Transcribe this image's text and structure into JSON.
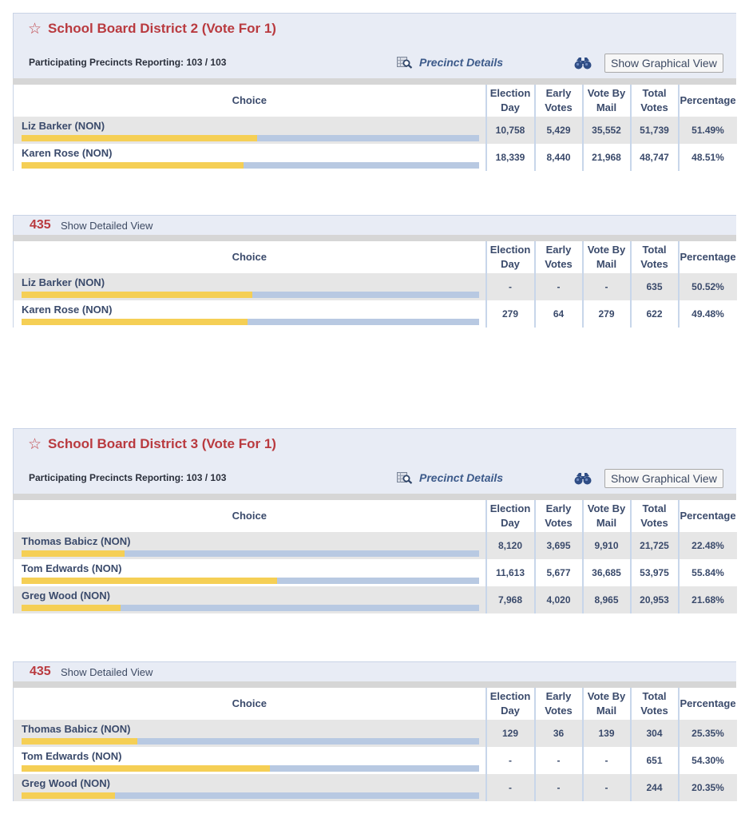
{
  "common": {
    "choice_header": "Choice",
    "columns": [
      {
        "line1": "Election",
        "line2": "Day"
      },
      {
        "line1": "Early",
        "line2": "Votes"
      },
      {
        "line1": "Vote By",
        "line2": "Mail"
      },
      {
        "line1": "Total",
        "line2": "Votes"
      },
      {
        "line1": "Percentage",
        "line2": ""
      }
    ],
    "precinct_details_label": "Precinct Details",
    "show_graphical_view_label": "Show Graphical View",
    "show_detailed_view_label": "Show Detailed View",
    "star_glyph": "☆",
    "colors": {
      "title": "#b93a3f",
      "bar_fill": "#f5cf55",
      "bar_track": "#b8c9e2",
      "header_bg": "#e8ecf5",
      "row_alt_bg": "#e6e6e6"
    }
  },
  "contests": [
    {
      "title": "School Board District 2 (Vote For 1)",
      "reporting": "Participating Precincts Reporting: 103 / 103",
      "rows": [
        {
          "name": "Liz Barker (NON)",
          "election_day": "10,758",
          "early": "5,429",
          "mail": "35,552",
          "total": "51,739",
          "pct": "51.49%",
          "share": 51.49
        },
        {
          "name": "Karen Rose (NON)",
          "election_day": "18,339",
          "early": "8,440",
          "mail": "21,968",
          "total": "48,747",
          "pct": "48.51%",
          "share": 48.51
        }
      ],
      "precinct": {
        "number": "435",
        "rows": [
          {
            "name": "Liz Barker (NON)",
            "election_day": "-",
            "early": "-",
            "mail": "-",
            "total": "635",
            "pct": "50.52%",
            "share": 50.52
          },
          {
            "name": "Karen Rose (NON)",
            "election_day": "279",
            "early": "64",
            "mail": "279",
            "total": "622",
            "pct": "49.48%",
            "share": 49.48
          }
        ]
      }
    },
    {
      "title": "School Board District 3 (Vote For 1)",
      "reporting": "Participating Precincts Reporting: 103 / 103",
      "rows": [
        {
          "name": "Thomas Babicz (NON)",
          "election_day": "8,120",
          "early": "3,695",
          "mail": "9,910",
          "total": "21,725",
          "pct": "22.48%",
          "share": 22.48
        },
        {
          "name": "Tom Edwards (NON)",
          "election_day": "11,613",
          "early": "5,677",
          "mail": "36,685",
          "total": "53,975",
          "pct": "55.84%",
          "share": 55.84
        },
        {
          "name": "Greg Wood (NON)",
          "election_day": "7,968",
          "early": "4,020",
          "mail": "8,965",
          "total": "20,953",
          "pct": "21.68%",
          "share": 21.68
        }
      ],
      "precinct": {
        "number": "435",
        "rows": [
          {
            "name": "Thomas Babicz (NON)",
            "election_day": "129",
            "early": "36",
            "mail": "139",
            "total": "304",
            "pct": "25.35%",
            "share": 25.35
          },
          {
            "name": "Tom Edwards (NON)",
            "election_day": "-",
            "early": "-",
            "mail": "-",
            "total": "651",
            "pct": "54.30%",
            "share": 54.3
          },
          {
            "name": "Greg Wood (NON)",
            "election_day": "-",
            "early": "-",
            "mail": "-",
            "total": "244",
            "pct": "20.35%",
            "share": 20.35
          }
        ]
      }
    }
  ]
}
